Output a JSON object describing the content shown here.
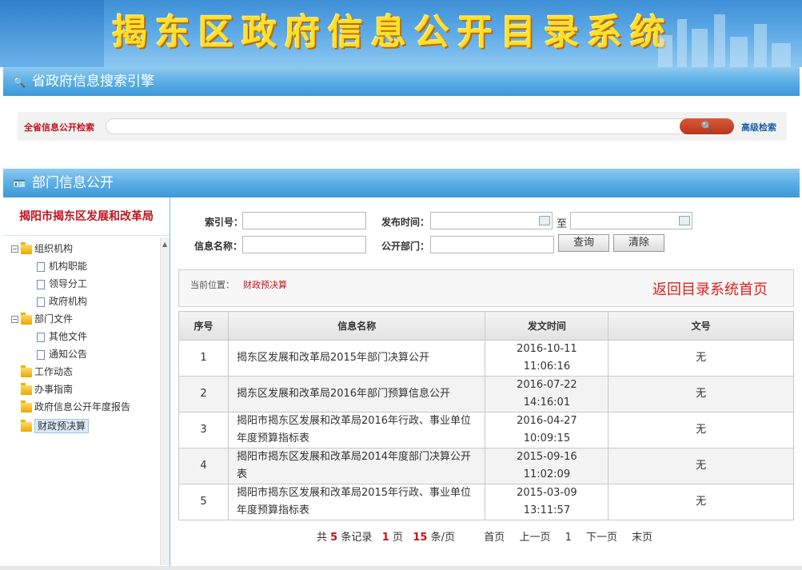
{
  "banner": {
    "title": "揭东区政府信息公开目录系统"
  },
  "search_section": {
    "title": "省政府信息搜索引擎",
    "label": "全省信息公开检索",
    "input_value": "",
    "search_button": "🔍",
    "advanced_link": "高级检索"
  },
  "dept_section": {
    "title": "部门信息公开"
  },
  "left_panel": {
    "dept_name": "揭阳市揭东区发展和改革局",
    "tree": [
      {
        "label": "组织机构",
        "toggle": "⊟"
      },
      {
        "label": "机构职能"
      },
      {
        "label": "领导分工"
      },
      {
        "label": "政府机构"
      },
      {
        "label": "部门文件",
        "toggle": "⊟"
      },
      {
        "label": "其他文件"
      },
      {
        "label": "通知公告"
      },
      {
        "label": "工作动态"
      },
      {
        "label": "办事指南"
      },
      {
        "label": "政府信息公开年度报告"
      },
      {
        "label": "财政预决算"
      }
    ]
  },
  "query_form": {
    "index_label": "索引号：",
    "index_value": "",
    "date_label": "发布时间：",
    "date_from": "",
    "date_to": "",
    "to_label": "至",
    "name_label": "信息名称：",
    "name_value": "",
    "dept_label": "公开部门：",
    "dept_value": "",
    "query_button": "查询",
    "clear_button": "清除"
  },
  "breadcrumb": {
    "label": "当前位置：",
    "current": "财政预决算",
    "home_link": "返回目录系统首页"
  },
  "table": {
    "headers": [
      "序号",
      "信息名称",
      "发文时间",
      "文号"
    ],
    "rows": [
      {
        "no": "1",
        "name": "揭东区发展和改革局2015年部门决算公开",
        "date": "2016-10-11 11:06:16",
        "doc": "无"
      },
      {
        "no": "2",
        "name": "揭东区发展和改革局2016年部门预算信息公开",
        "date": "2016-07-22 14:16:01",
        "doc": "无"
      },
      {
        "no": "3",
        "name": "揭阳市揭东区发展和改革局2016年行政、事业单位年度预算指标表",
        "date": "2016-04-27 10:09:15",
        "doc": "无"
      },
      {
        "no": "4",
        "name": "揭阳市揭东区发展和改革局2014年度部门决算公开表",
        "date": "2015-09-16 11:02:09",
        "doc": "无"
      },
      {
        "no": "5",
        "name": "揭阳市揭东区发展和改革局2015年行政、事业单位年度预算指标表",
        "date": "2015-03-09 13:11:57",
        "doc": "无"
      }
    ]
  },
  "pager": {
    "total_prefix": "共",
    "total": "5",
    "total_suffix": "条记录",
    "pages": "1",
    "pages_suffix": "页",
    "per_page": "15",
    "per_page_suffix": "条/页",
    "first": "首页",
    "prev": "上一页",
    "current": "1",
    "next": "下一页",
    "last": "末页"
  },
  "colors": {
    "accent_blue": "#3d98da",
    "accent_red": "#c0141c",
    "title_yellow": "#ffe02a"
  }
}
